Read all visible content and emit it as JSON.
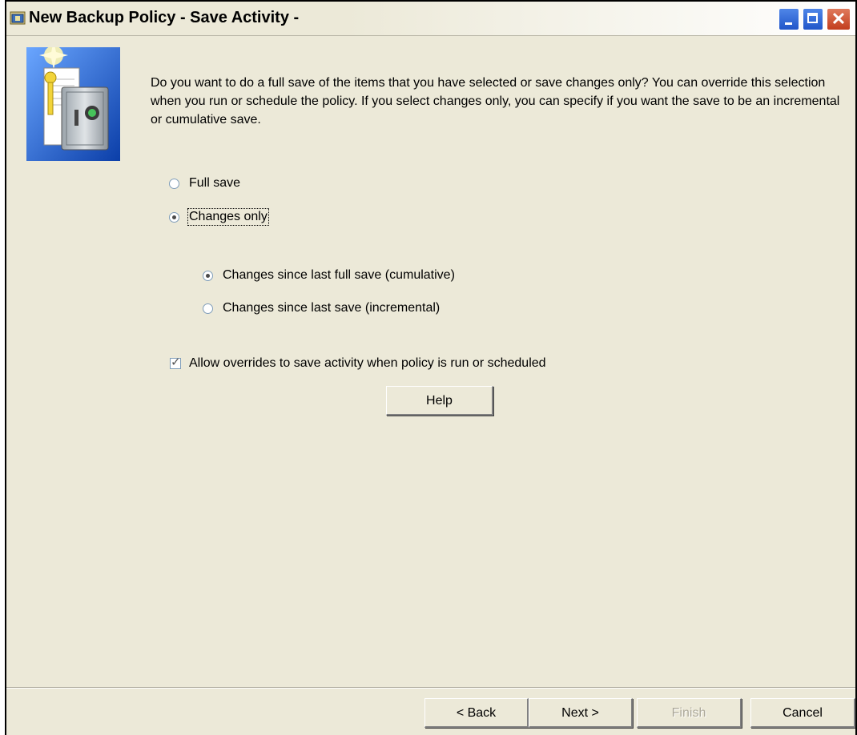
{
  "window": {
    "title": "New Backup Policy - Save Activity -",
    "controls": {
      "minimize_icon": "minimize-icon",
      "maximize_icon": "maximize-icon",
      "close_icon": "close-icon"
    }
  },
  "intro_text": "Do you want to do a full save of the items that you have selected or save changes only?  You can override this selection when you run or schedule the policy.  If you select changes only, you can specify if you want the save to be an incremental or cumulative save.",
  "save_type": {
    "options": [
      {
        "label": "Full save",
        "selected": false
      },
      {
        "label": "Changes only",
        "selected": true
      }
    ]
  },
  "changes_type": {
    "options": [
      {
        "label": "Changes since last full save (cumulative)",
        "selected": true
      },
      {
        "label": "Changes since last save (incremental)",
        "selected": false
      }
    ]
  },
  "allow_overrides": {
    "label": "Allow overrides to save activity when policy is run or scheduled",
    "checked": true
  },
  "buttons": {
    "help": "Help",
    "back": "< Back",
    "next": "Next >",
    "finish": "Finish",
    "cancel": "Cancel"
  },
  "colors": {
    "dialog_bg": "#ece9d8",
    "title_close": "#c23d1d",
    "title_buttons": "#2156c9"
  },
  "icons": {
    "wizard_image": "safe-with-key-icon",
    "title_icon": "app-window-icon"
  }
}
